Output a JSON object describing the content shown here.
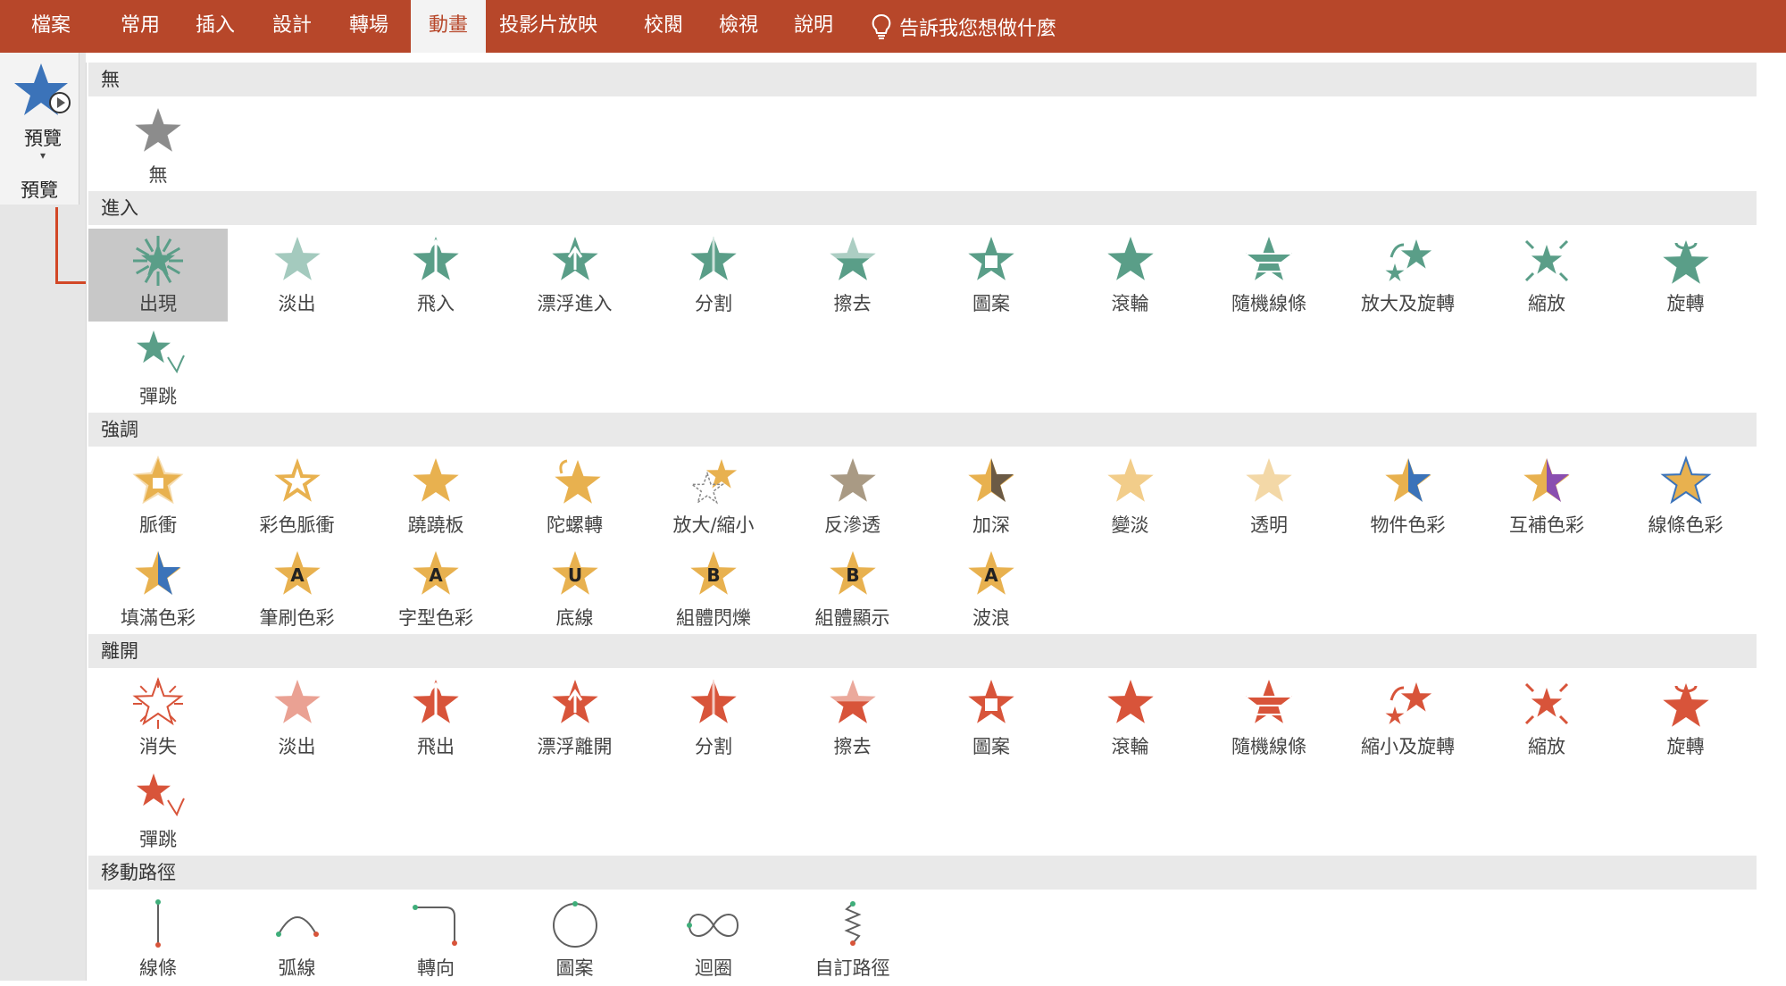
{
  "ribbon": {
    "tabs": [
      {
        "label": "檔案",
        "active": false
      },
      {
        "label": "常用",
        "active": false
      },
      {
        "label": "插入",
        "active": false
      },
      {
        "label": "設計",
        "active": false
      },
      {
        "label": "轉場",
        "active": false
      },
      {
        "label": "動畫",
        "active": true
      },
      {
        "label": "投影片放映",
        "active": false
      },
      {
        "label": "校閱",
        "active": false
      },
      {
        "label": "檢視",
        "active": false
      },
      {
        "label": "說明",
        "active": false
      }
    ],
    "tell_me": "告訴我您想做什麼",
    "tell_me_icon": "lightbulb-icon"
  },
  "preview_group": {
    "button_label": "預覽",
    "group_label": "預覽",
    "icon": "star-play-icon"
  },
  "colors": {
    "ribbon": "#b7472a",
    "entrance": "#5a9e88",
    "emphasis": "#e8b14f",
    "exit": "#d8543a",
    "none": "#8c8c8c",
    "path_line": "#606060",
    "selected_bg": "#c8c8c8"
  },
  "gallery": {
    "sections": [
      {
        "key": "none",
        "title": "無",
        "items": [
          {
            "label": "無",
            "icon": "star-none-icon"
          }
        ]
      },
      {
        "key": "entrance",
        "title": "進入",
        "items": [
          {
            "label": "出現",
            "icon": "appear-icon",
            "selected": true
          },
          {
            "label": "淡出",
            "icon": "fade-icon"
          },
          {
            "label": "飛入",
            "icon": "fly-in-icon"
          },
          {
            "label": "漂浮進入",
            "icon": "float-in-icon"
          },
          {
            "label": "分割",
            "icon": "split-icon"
          },
          {
            "label": "擦去",
            "icon": "wipe-icon"
          },
          {
            "label": "圖案",
            "icon": "shape-icon"
          },
          {
            "label": "滾輪",
            "icon": "wheel-icon"
          },
          {
            "label": "隨機線條",
            "icon": "random-bars-icon"
          },
          {
            "label": "放大及旋轉",
            "icon": "grow-turn-icon"
          },
          {
            "label": "縮放",
            "icon": "zoom-icon"
          },
          {
            "label": "旋轉",
            "icon": "swivel-icon"
          },
          {
            "label": "彈跳",
            "icon": "bounce-icon"
          }
        ]
      },
      {
        "key": "emphasis",
        "title": "強調",
        "items": [
          {
            "label": "脈衝",
            "icon": "pulse-icon"
          },
          {
            "label": "彩色脈衝",
            "icon": "color-pulse-icon"
          },
          {
            "label": "蹺蹺板",
            "icon": "teeter-icon"
          },
          {
            "label": "陀螺轉",
            "icon": "spin-icon"
          },
          {
            "label": "放大/縮小",
            "icon": "grow-shrink-icon"
          },
          {
            "label": "反滲透",
            "icon": "desaturate-icon"
          },
          {
            "label": "加深",
            "icon": "darken-icon"
          },
          {
            "label": "變淡",
            "icon": "lighten-icon"
          },
          {
            "label": "透明",
            "icon": "transparency-icon"
          },
          {
            "label": "物件色彩",
            "icon": "object-color-icon"
          },
          {
            "label": "互補色彩",
            "icon": "complementary-color-icon"
          },
          {
            "label": "線條色彩",
            "icon": "line-color-icon"
          },
          {
            "label": "填滿色彩",
            "icon": "fill-color-icon"
          },
          {
            "label": "筆刷色彩",
            "icon": "brush-color-icon",
            "letter": "A"
          },
          {
            "label": "字型色彩",
            "icon": "font-color-icon",
            "letter": "A"
          },
          {
            "label": "底線",
            "icon": "underline-icon",
            "letter": "U"
          },
          {
            "label": "組體閃爍",
            "icon": "bold-flash-icon",
            "letter": "B"
          },
          {
            "label": "組體顯示",
            "icon": "bold-reveal-icon",
            "letter": "B"
          },
          {
            "label": "波浪",
            "icon": "wave-icon",
            "letter": "A"
          }
        ]
      },
      {
        "key": "exit",
        "title": "離開",
        "items": [
          {
            "label": "消失",
            "icon": "disappear-icon"
          },
          {
            "label": "淡出",
            "icon": "fade-out-icon"
          },
          {
            "label": "飛出",
            "icon": "fly-out-icon"
          },
          {
            "label": "漂浮離開",
            "icon": "float-out-icon"
          },
          {
            "label": "分割",
            "icon": "split-icon"
          },
          {
            "label": "擦去",
            "icon": "wipe-icon"
          },
          {
            "label": "圖案",
            "icon": "shape-icon"
          },
          {
            "label": "滾輪",
            "icon": "wheel-icon"
          },
          {
            "label": "隨機線條",
            "icon": "random-bars-icon"
          },
          {
            "label": "縮小及旋轉",
            "icon": "shrink-turn-icon"
          },
          {
            "label": "縮放",
            "icon": "zoom-icon"
          },
          {
            "label": "旋轉",
            "icon": "swivel-icon"
          },
          {
            "label": "彈跳",
            "icon": "bounce-icon"
          }
        ]
      },
      {
        "key": "path",
        "title": "移動路徑",
        "items": [
          {
            "label": "線條",
            "icon": "line-path-icon"
          },
          {
            "label": "弧線",
            "icon": "arc-path-icon"
          },
          {
            "label": "轉向",
            "icon": "turn-path-icon"
          },
          {
            "label": "圖案",
            "icon": "shape-path-icon"
          },
          {
            "label": "迴圈",
            "icon": "loop-path-icon"
          },
          {
            "label": "自訂路徑",
            "icon": "custom-path-icon"
          }
        ]
      }
    ]
  }
}
